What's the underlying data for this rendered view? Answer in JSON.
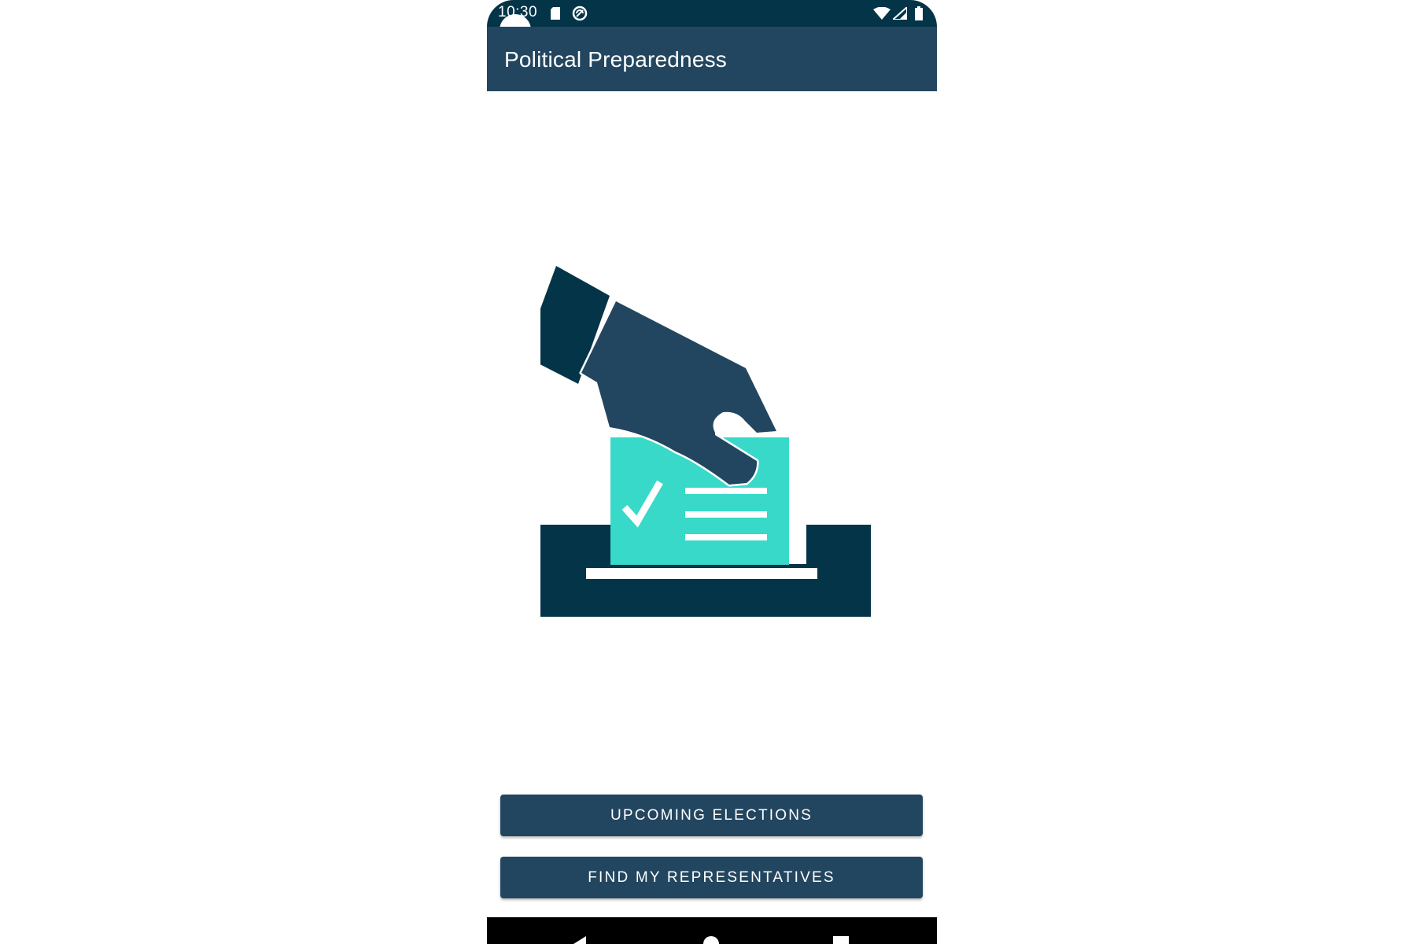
{
  "status_bar": {
    "time": "10:30",
    "icons": [
      "sd-card-icon",
      "sync-icon",
      "wifi-icon",
      "signal-icon",
      "battery-icon"
    ]
  },
  "app_bar": {
    "title": "Political Preparedness"
  },
  "illustration": {
    "icon": "ballot-box-vote-icon",
    "colors": {
      "dark": "#043448",
      "hand": "#234660",
      "ballot": "#38d9c9"
    }
  },
  "actions": {
    "upcoming_elections_label": "UPCOMING ELECTIONS",
    "find_representatives_label": "FIND MY REPRESENTATIVES"
  },
  "nav_bar": {
    "icons": [
      "back-icon",
      "home-icon",
      "recents-icon"
    ]
  },
  "theme": {
    "primary": "#234660",
    "primary_dark": "#043448",
    "accent": "#38d9c9",
    "background": "#ffffff"
  }
}
